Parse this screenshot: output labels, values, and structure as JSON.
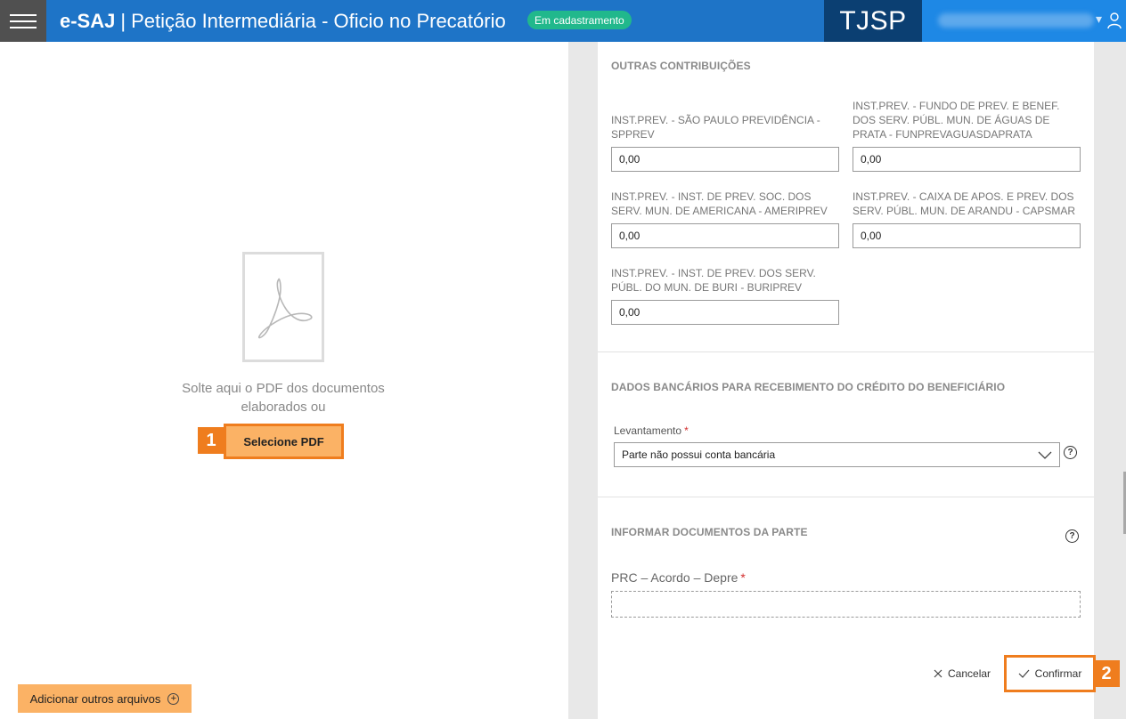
{
  "header": {
    "logo": "e-SAJ",
    "separator": "|",
    "title": "Petição Intermediária - Oficio no Precatório",
    "status_badge": "Em cadastramento",
    "court": "TJSP",
    "menu_icon": "hamburger-icon",
    "user_icon": "user-icon"
  },
  "left": {
    "drop_text": "Solte aqui o PDF dos documentos elaborados ou",
    "select_pdf": "Selecione PDF",
    "marker_1": "1",
    "add_files": "Adicionar outros arquivos"
  },
  "outras": {
    "title": "OUTRAS CONTRIBUIÇÕES",
    "fields": [
      {
        "label": "INST.PREV. - SÃO PAULO PREVIDÊNCIA - SPPREV",
        "value": "0,00"
      },
      {
        "label": "INST.PREV. - FUNDO DE PREV. E BENEF. DOS SERV. PÚBL. MUN. DE ÁGUAS DE PRATA - FUNPREVAGUASDAPRATA",
        "value": "0,00"
      },
      {
        "label": "INST.PREV. - INST. DE PREV. SOC. DOS SERV. MUN. DE AMERICANA - AMERIPREV",
        "value": "0,00"
      },
      {
        "label": "INST.PREV. - CAIXA DE APOS. E PREV. DOS SERV. PÚBL. MUN. DE ARANDU - CAPSMAR",
        "value": "0,00"
      },
      {
        "label": "INST.PREV. - INST. DE PREV. DOS SERV. PÚBL. DO MUN. DE BURI - BURIPREV",
        "value": "0,00"
      }
    ]
  },
  "bancarios": {
    "title": "DADOS BANCÁRIOS PARA RECEBIMENTO DO CRÉDITO DO BENEFICIÁRIO",
    "levantamento_label": "Levantamento",
    "required_mark": "*",
    "levantamento_value": "Parte não possui conta bancária",
    "help": "?"
  },
  "documentos": {
    "title": "INFORMAR DOCUMENTOS DA PARTE",
    "help": "?",
    "doc_label": "PRC – Acordo – Depre",
    "required_mark": "*"
  },
  "actions": {
    "cancel": "Cancelar",
    "confirm": "Confirmar",
    "marker_2": "2"
  },
  "colors": {
    "header_bg": "#1e74c7",
    "court_bg": "#0b3f72",
    "badge_bg": "#21b88c",
    "highlight": "#ef7d1e",
    "button_orange": "#fbb265"
  }
}
